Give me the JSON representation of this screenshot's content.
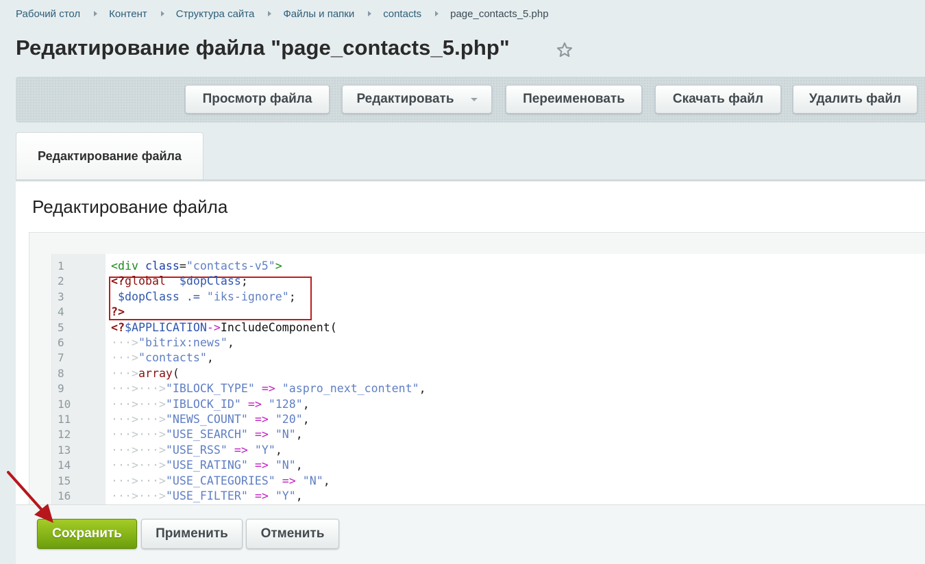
{
  "breadcrumbs": [
    {
      "label": "Рабочий стол"
    },
    {
      "label": "Контент"
    },
    {
      "label": "Структура сайта"
    },
    {
      "label": "Файлы и папки"
    },
    {
      "label": "contacts"
    },
    {
      "label": "page_contacts_5.php"
    }
  ],
  "page_title": "Редактирование файла \"page_contacts_5.php\"",
  "favorite_icon": "star-icon",
  "toolbar": {
    "view_file": "Просмотр файла",
    "edit": "Редактировать",
    "rename": "Переименовать",
    "download": "Скачать файл",
    "delete": "Удалить файл"
  },
  "tabs": [
    {
      "label": "Редактирование файла",
      "active": true
    }
  ],
  "section_title": "Редактирование файла",
  "editor": {
    "lines": [
      {
        "n": "1",
        "tokens": [
          [
            "tag",
            "<div "
          ],
          [
            "attr",
            "class"
          ],
          [
            "punc",
            "="
          ],
          [
            "str",
            "\"contacts-v5\""
          ],
          [
            "tag",
            ">"
          ]
        ]
      },
      {
        "n": "2",
        "tokens": [
          [
            "ph",
            "<?"
          ],
          [
            "kw",
            "global"
          ],
          [
            "punc",
            "  "
          ],
          [
            "var",
            "$dopClass"
          ],
          [
            "punc",
            ";"
          ]
        ]
      },
      {
        "n": "3",
        "tokens": [
          [
            "punc",
            " "
          ],
          [
            "var",
            "$dopClass"
          ],
          [
            "punc",
            " "
          ],
          [
            "var",
            ".="
          ],
          [
            "punc",
            " "
          ],
          [
            "str",
            "\"iks-ignore\""
          ],
          [
            "punc",
            ";"
          ]
        ]
      },
      {
        "n": "4",
        "tokens": [
          [
            "ph",
            "?>"
          ]
        ]
      },
      {
        "n": "5",
        "tokens": [
          [
            "ph",
            "<?"
          ],
          [
            "var",
            "$APPLICATION"
          ],
          [
            "op",
            "->"
          ],
          [
            "fn",
            "IncludeComponent("
          ]
        ]
      },
      {
        "n": "6",
        "tokens": [
          [
            "ws",
            "···>"
          ],
          [
            "str",
            "\"bitrix:news\""
          ],
          [
            "punc",
            ","
          ]
        ]
      },
      {
        "n": "7",
        "tokens": [
          [
            "ws",
            "···>"
          ],
          [
            "str",
            "\"contacts\""
          ],
          [
            "punc",
            ","
          ]
        ]
      },
      {
        "n": "8",
        "tokens": [
          [
            "ws",
            "···>"
          ],
          [
            "kw",
            "array"
          ],
          [
            "punc",
            "("
          ]
        ]
      },
      {
        "n": "9",
        "tokens": [
          [
            "ws",
            "···>···>"
          ],
          [
            "str",
            "\"IBLOCK_TYPE\""
          ],
          [
            "punc",
            " "
          ],
          [
            "op",
            "=>"
          ],
          [
            "punc",
            " "
          ],
          [
            "str",
            "\"aspro_next_content\""
          ],
          [
            "punc",
            ","
          ]
        ]
      },
      {
        "n": "10",
        "tokens": [
          [
            "ws",
            "···>···>"
          ],
          [
            "str",
            "\"IBLOCK_ID\""
          ],
          [
            "punc",
            " "
          ],
          [
            "op",
            "=>"
          ],
          [
            "punc",
            " "
          ],
          [
            "str",
            "\"128\""
          ],
          [
            "punc",
            ","
          ]
        ]
      },
      {
        "n": "11",
        "tokens": [
          [
            "ws",
            "···>···>"
          ],
          [
            "str",
            "\"NEWS_COUNT\""
          ],
          [
            "punc",
            " "
          ],
          [
            "op",
            "=>"
          ],
          [
            "punc",
            " "
          ],
          [
            "str",
            "\"20\""
          ],
          [
            "punc",
            ","
          ]
        ]
      },
      {
        "n": "12",
        "tokens": [
          [
            "ws",
            "···>···>"
          ],
          [
            "str",
            "\"USE_SEARCH\""
          ],
          [
            "punc",
            " "
          ],
          [
            "op",
            "=>"
          ],
          [
            "punc",
            " "
          ],
          [
            "str",
            "\"N\""
          ],
          [
            "punc",
            ","
          ]
        ]
      },
      {
        "n": "13",
        "tokens": [
          [
            "ws",
            "···>···>"
          ],
          [
            "str",
            "\"USE_RSS\""
          ],
          [
            "punc",
            " "
          ],
          [
            "op",
            "=>"
          ],
          [
            "punc",
            " "
          ],
          [
            "str",
            "\"Y\""
          ],
          [
            "punc",
            ","
          ]
        ]
      },
      {
        "n": "14",
        "tokens": [
          [
            "ws",
            "···>···>"
          ],
          [
            "str",
            "\"USE_RATING\""
          ],
          [
            "punc",
            " "
          ],
          [
            "op",
            "=>"
          ],
          [
            "punc",
            " "
          ],
          [
            "str",
            "\"N\""
          ],
          [
            "punc",
            ","
          ]
        ]
      },
      {
        "n": "15",
        "tokens": [
          [
            "ws",
            "···>···>"
          ],
          [
            "str",
            "\"USE_CATEGORIES\""
          ],
          [
            "punc",
            " "
          ],
          [
            "op",
            "=>"
          ],
          [
            "punc",
            " "
          ],
          [
            "str",
            "\"N\""
          ],
          [
            "punc",
            ","
          ]
        ]
      },
      {
        "n": "16",
        "tokens": [
          [
            "ws",
            "···>···>"
          ],
          [
            "str",
            "\"USE_FILTER\""
          ],
          [
            "punc",
            " "
          ],
          [
            "op",
            "=>"
          ],
          [
            "punc",
            " "
          ],
          [
            "str",
            "\"Y\""
          ],
          [
            "punc",
            ","
          ]
        ]
      }
    ]
  },
  "actions": {
    "save": "Сохранить",
    "apply": "Применить",
    "cancel": "Отменить"
  },
  "colors": {
    "save_button": "#7fb01a",
    "highlight_box": "#c01a1a",
    "annotation_arrow": "#b5171d"
  }
}
